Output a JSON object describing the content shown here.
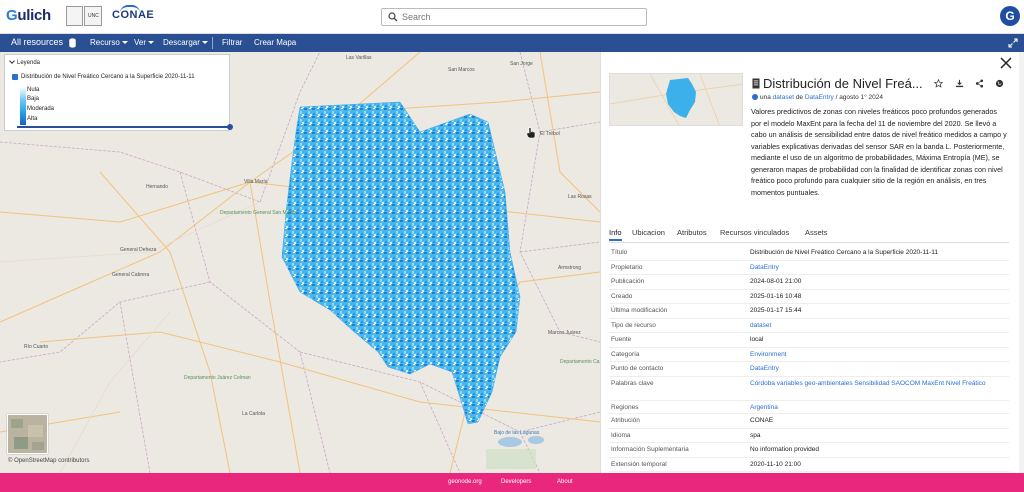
{
  "header": {
    "brand": "Gulich",
    "unc_logo_text": "UNC",
    "conae_logo_text": "CONAE",
    "search_placeholder": "Search",
    "avatar_initial": "G"
  },
  "toolbar": {
    "all_resources": "All resources",
    "recurso": "Recurso",
    "ver": "Ver",
    "descargar": "Descargar",
    "filtrar": "Filtrar",
    "crear_mapa": "Crear Mapa"
  },
  "legend": {
    "title": "Leyenda",
    "layer_name": "Distribución de Nivel Freático Cercano a la Superficie 2020-11-11",
    "classes": [
      "Nula",
      "Baja",
      "Moderada",
      "Alta"
    ]
  },
  "map": {
    "places": {
      "las_varillas": "Las Varillas",
      "san_jorge": "San Jorge",
      "el_trebol": "El Trébol",
      "las_rosas": "Las Rosas",
      "villa_maria": "Villa María",
      "hernando": "Hernando",
      "dpto_san_martin": "Departamento General San Martín",
      "general_deheza": "General Deheza",
      "general_cabrera": "General Cabrera",
      "rio_cuarto": "Río Cuarto",
      "armstrong": "Armstrong",
      "marcos_juarez": "Marcos Juárez",
      "dpto_juarez_celman": "Departamento Juárez Celman",
      "la_carlota": "La Carlota",
      "dpto_caseros": "Departamento Caseros",
      "bajo_de_las_lagunas": "Bajo de las Lagunas",
      "san_marcos": "San Marcos"
    },
    "attribution": "© OpenStreetMap contributors"
  },
  "panel": {
    "title": "Distribución de Nivel Freá...",
    "byline_prefix": "una",
    "byline_type": "dataset",
    "byline_de": "de",
    "byline_owner": "DataEntry",
    "byline_date": "/ agosto 1° 2024",
    "description": "Valores predictivos de zonas con niveles freáticos poco profundos generados por el modelo MaxEnt para la fecha del 11 de noviembre del 2020. Se llevó a cabo un análisis de sensibilidad entre datos de nivel freático medidos a campo y variables explicativas derivadas del sensor SAR en la banda L. Posteriormente, mediante el uso de un algoritmo de probabilidades, Máxima Entropía (ME), se generaron mapas de probabilidad con la finalidad de identificar zonas con nivel freático poco profundo para cualquier sitio de la región en análisis, en tres momentos puntuales.",
    "tabs": [
      "Info",
      "Ubicacion",
      "Atributos",
      "Recursos vinculados",
      "Assets"
    ],
    "info_rows": [
      {
        "key": "Título",
        "value": "Distribución de Nivel Freático Cercano a la Superficie 2020-11-11",
        "link": false
      },
      {
        "key": "Propietario",
        "value": "DataEntry",
        "link": true
      },
      {
        "key": "Publicación",
        "value": "2024-08-01 21:00",
        "link": false
      },
      {
        "key": "Creado",
        "value": "2025-01-16 10:48",
        "link": false
      },
      {
        "key": "Última modificación",
        "value": "2025-01-17 15:44",
        "link": false
      },
      {
        "key": "Tipo de recurso",
        "value": "dataset",
        "link": true
      },
      {
        "key": "Fuente",
        "value": "local",
        "link": false
      },
      {
        "key": "Categoría",
        "value": "Environment",
        "link": true
      },
      {
        "key": "Punto de contacto",
        "value": "DataEntry",
        "link": true
      },
      {
        "key": "Palabras clave",
        "value": "Córdoba  variables geo-ambientales  Sensibilidad  SAOCOM  MaxEnt  Nivel Freático",
        "link": true
      },
      {
        "key": "Regiones",
        "value": "Argentina",
        "link": true
      },
      {
        "key": "Atribución",
        "value": "CONAE",
        "link": false
      },
      {
        "key": "Idioma",
        "value": "spa",
        "link": false
      },
      {
        "key": "Información Suplementaria",
        "value": "No information provided",
        "link": false
      },
      {
        "key": "Extensión temporal",
        "value": "2020-11-10 21:00",
        "link": false
      }
    ]
  },
  "footer": {
    "geonode": "geonode.org",
    "developers": "Developers",
    "about": "About"
  },
  "colors": {
    "toolbar_bg": "#2b4f93",
    "footer_bg": "#e8277d",
    "raster_light": "#6cc7f0",
    "raster_dark": "#1a5fc6",
    "link": "#2a6fd1"
  }
}
